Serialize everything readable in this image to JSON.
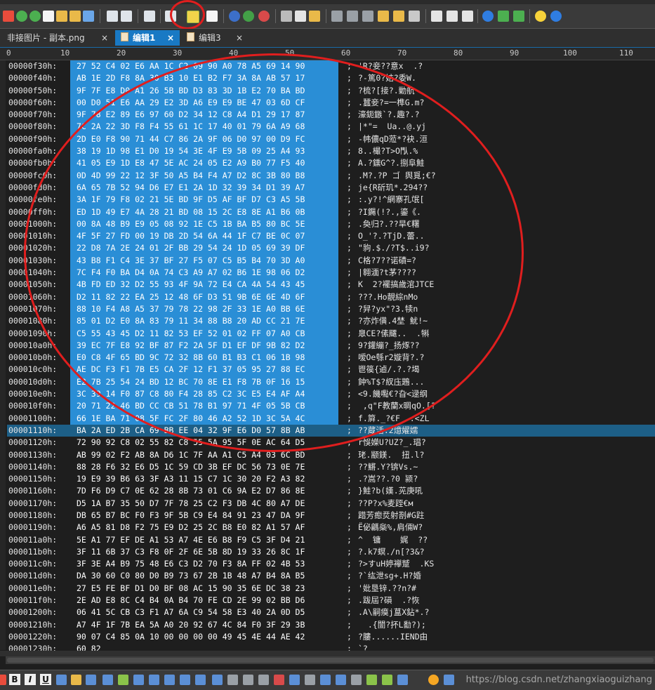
{
  "tabs": [
    {
      "label": "非接图片 - 副本.png",
      "close": "×"
    },
    {
      "label": "编辑1",
      "close": "×"
    },
    {
      "label": "编辑3",
      "close": "×"
    }
  ],
  "ruler": [
    "0",
    "10",
    "20",
    "30",
    "40",
    "50",
    "60",
    "70",
    "80",
    "90",
    "100",
    "110"
  ],
  "separator": ";",
  "rows": [
    {
      "addr": "00000f30h:",
      "hex": "27 52 C4 02 E6 AA 1C C2 09 90 A0 78 A5 69 14 90",
      "ascii": "'R?妾??意x  .?",
      "sel": true
    },
    {
      "addr": "00000f40h:",
      "hex": "AB 1E 2D F8 8A 30 B3 10 E1 B2 F7 3A 8A AB 57 17",
      "ascii": "?-篤0?姞?委W.",
      "sel": true
    },
    {
      "addr": "00000f50h:",
      "hex": "9F 7F E8 D0 A1 26 5B BD D3 83 3D 1B E2 70 BA BD",
      "ascii": "?梳?[接?.勦航",
      "sel": true
    },
    {
      "addr": "00000f60h:",
      "hex": "00 D0 51 E6 AA 29 E2 3D A6 E9 E9 BE 47 03 6D CF",
      "ascii": ".蠶妾?=一榫G.m?",
      "sel": true
    },
    {
      "addr": "00000f70h:",
      "hex": "9F 78 E2 89 E6 97 60 D2 34 12 C8 A4 D1 29 17 87",
      "ascii": "濠鈪鏃`?.趣?.?",
      "sel": true
    },
    {
      "addr": "00000f80h:",
      "hex": "7C 2A 22 3D F8 F4 55 61 1C 17 40 01 79 6A A9 68",
      "ascii": "|*\"=  Ua..@.yj",
      "sel": true
    },
    {
      "addr": "00000f90h:",
      "hex": "2D E0 F8 90 71 44 C7 86 2A 9F 06 D0 97 00 D9 FC",
      "ascii": "-帏儂qD蒞*?袂.洹",
      "sel": true
    },
    {
      "addr": "00000fa0h:",
      "hex": "38 19 1D 98 E1 D0 19 54 3E 4F E9 5B 09 25 A4 93",
      "ascii": "8..樶?T>O閄.%",
      "sel": true
    },
    {
      "addr": "00000fb0h:",
      "hex": "41 05 E9 1D E8 47 5E AC 24 05 E2 A9 B0 77 F5 40",
      "ascii": "A.?鑂G^?.捌阜鮭",
      "sel": true
    },
    {
      "addr": "00000fc0h:",
      "hex": "0D 4D 99 22 12 3F 50 A5 B4 F4 A7 D2 8C 3B 80 B8",
      "ascii": ".M?.?P ゴ 舆覓;€?",
      "sel": true
    },
    {
      "addr": "00000fd0h:",
      "hex": "6A 65 7B 52 94 D6 E7 E1 2A 1D 32 39 34 D1 39 A7",
      "ascii": "je{R斫玑*.294??",
      "sel": true
    },
    {
      "addr": "00000fe0h:",
      "hex": "3A 1F 79 F8 02 21 5E BD 9F D5 AF BF D7 C3 A5 5B",
      "ascii": ":.y?!^網寨孔氓[",
      "sel": true
    },
    {
      "addr": "00000ff0h:",
      "hex": "ED 1D 49 E7 4A 28 21 BD 08 15 2C E8 8E A1 B6 0B",
      "ascii": "?I鐊(!?.,鎏《.",
      "sel": true
    },
    {
      "addr": "00001000h:",
      "hex": "00 8A 48 B9 E9 05 08 92 1E C5 1B BA B5 80 BC 5E",
      "ascii": ".奐归?.??旱€糬",
      "sel": true
    },
    {
      "addr": "00001010h:",
      "hex": "4F 5F 27 FD 00 19 DB 2D 54 6A 44 1F C7 BE 0C 07",
      "ascii": "O_'?.?TjD.蕾..",
      "sel": true
    },
    {
      "addr": "00001020h:",
      "hex": "22 D8 7A 2E 24 01 2F BB 29 54 24 1D 05 69 39 DF",
      "ascii": "\"豿.$./?T$..i9?",
      "sel": true
    },
    {
      "addr": "00001030h:",
      "hex": "43 B8 F1 C4 3E 37 BF 27 F5 07 C5 B5 B4 70 3D A0",
      "ascii": "C格?7??诺磧=?",
      "sel": true
    },
    {
      "addr": "00001040h:",
      "hex": "7C F4 F0 BA D4 0A 74 C3 A9 A7 02 B6 1E 98 06 D2",
      "ascii": "|翱湎?t茅????",
      "sel": true
    },
    {
      "addr": "00001050h:",
      "hex": "4B FD ED 32 D2 55 93 4F 9A 72 E4 CA 4A 54 43 45",
      "ascii": "K  2?襬搞歲涫JTCE",
      "sel": true
    },
    {
      "addr": "00001060h:",
      "hex": "D2 11 82 22 EA 25 12 48 6F D3 51 9B 6E 6E 4D 6F",
      "ascii": "???.Ho靚綜nMo",
      "sel": true
    },
    {
      "addr": "00001070h:",
      "hex": "88 10 F4 A8 A5 37 79 78 22 98 2F 33 1E A0 BB 6E",
      "ascii": "?舁?yx\"?3.犊n",
      "sel": true
    },
    {
      "addr": "00001080h:",
      "hex": "85 01 D2 E0 8A 83 79 11 34 88 B8 20 AD CC 21 7E",
      "ascii": "?亦炸僙.4埜 魷!~",
      "sel": true
    },
    {
      "addr": "00001090h:",
      "hex": "C5 55 43 45 D2 11 82 53 EF 52 01 02 FF 07 A0 CB",
      "ascii": "臮CE?傃飅..  .犐",
      "sel": true
    },
    {
      "addr": "000010a0h:",
      "hex": "39 EC 7F E8 92 BF 87 F2 2A 5F D1 EF DF 9B 82 D2",
      "ascii": "9?鑵繃?_扬烼??",
      "sel": true
    },
    {
      "addr": "000010b0h:",
      "hex": "E0 C8 4F 65 BD 9C 72 32 8B 60 B1 B3 C1 06 1B 98",
      "ascii": "嗳Oe綔r2嫙背?.?",
      "sel": true
    },
    {
      "addr": "000010c0h:",
      "hex": "AE DC F3 F1 7B E5 CA 2F 12 F1 37 05 95 27 88 EC",
      "ascii": "鬯篌{逌/.?.?堨",
      "sel": true
    },
    {
      "addr": "000010d0h:",
      "hex": "E2 7B 25 54 24 BD 12 BC 70 8E E1 F8 7B 0F 16 15",
      "ascii": "鈡%T$?紁庒鶗...",
      "sel": true
    },
    {
      "addr": "000010e0h:",
      "hex": "3C 39 14 F0 87 C8 80 F4 28 85 C2 3C E5 E4 AF A4",
      "ascii": "<9.饑嚸€?旮<逯纲",
      "sel": true
    },
    {
      "addr": "000010f0h:",
      "hex": "20 71 22 46 BD CC CB 51 78 B1 97 71 4F 05 5B CB",
      "ascii": " ,q\"F教蘭x晭qO.[?",
      "sel": true
    },
    {
      "addr": "00001100h:",
      "hex": "66 1E BA 71 08 5F FC 2F 80 46 A2 52 1D 3C 5A 4C",
      "ascii": "f.簈._?€F  .<ZL",
      "sel": true
    },
    {
      "addr": "00001110h:",
      "hex": "BA 2A ED 2B CA 69 BB EE 04 32 9F E6 D0 57 8B AB",
      "ascii": "??蔵活.2燱嬥嬬",
      "sel": true,
      "cur": true
    },
    {
      "addr": "00001120h:",
      "hex": "72 90 92 C8 02 55 82 C8 55 5A 95 5F 0E AC 64 D5",
      "ascii": "r悞嬫U?UZ?_.琩?",
      "sel": false
    },
    {
      "addr": "00001130h:",
      "hex": "AB 99 02 F2 AB 8A D6 1C 7F AA A1 C5 A4 03 6C BD",
      "ascii": "珯.颛鎂.  扭.l?",
      "sel": false
    },
    {
      "addr": "00001140h:",
      "hex": "88 28 F6 32 E6 D5 1C 59 CD 3B EF DC 56 73 0E 7E",
      "ascii": "??鱂.Y?锛Vs.~",
      "sel": false
    },
    {
      "addr": "00001150h:",
      "hex": "19 E9 39 B6 63 3F A3 11 15 C7 1C 30 20 F2 A3 82",
      "ascii": ".?嵩??.?0 颍?",
      "sel": false
    },
    {
      "addr": "00001160h:",
      "hex": "7D F6 D9 C7 0E 62 28 8B 73 01 C6 9A E2 D7 86 8E",
      "ascii": "}鮭?b(嫨.茪庚吼",
      "sel": false
    },
    {
      "addr": "00001170h:",
      "hex": "D5 1A B7 35 50 D7 7F 78 25 C2 F3 DB 4C 80 A7 DE",
      "ascii": "??P?x%麦跮€м",
      "sel": false
    },
    {
      "addr": "00001180h:",
      "hex": "DB 65 B7 BC F0 F3 9F 5B C9 E4 84 91 23 47 DA 9F",
      "ascii": "踖芳瘛烎射剳#G跓",
      "sel": false
    },
    {
      "addr": "00001190h:",
      "hex": "A6 A5 81 D8 F2 75 E9 D2 25 2C B8 E0 82 A1 57 AF",
      "ascii": "Ё佖騗橤%,肩倆W?",
      "sel": false
    },
    {
      "addr": "000011a0h:",
      "hex": "5E A1 77 EF DE A1 53 A7 4E E6 B8 F9 C5 3F D4 21",
      "ascii": "^  镛    娓  ??",
      "sel": false
    },
    {
      "addr": "000011b0h:",
      "hex": "3F 11 6B 37 C3 F8 0F 2F 6E 5B 8D 19 33 26 8C 1F",
      "ascii": "?.k7螟./n[?3&?",
      "sel": false
    },
    {
      "addr": "000011c0h:",
      "hex": "3F 3E A4 B9 75 48 E6 C3 D2 70 F3 8A FF 02 4B 53",
      "ascii": "?>すuH婷襷蹵  .KS",
      "sel": false
    },
    {
      "addr": "000011d0h:",
      "hex": "DA 30 60 C0 80 D0 B9 73 67 2B 1B 48 A7 B4 8A B5",
      "ascii": "?`纮泄sg+.H?婚",
      "sel": false
    },
    {
      "addr": "000011e0h:",
      "hex": "27 E5 FE BF D1 D0 BF 08 AC 15 90 35 6E DC 38 23",
      "ascii": "'妣垦锌.??n?#",
      "sel": false
    },
    {
      "addr": "000011f0h:",
      "hex": "2E AD E8 8C C4 B4 0A B4 70 FE CD 2E 99 02 BB D6",
      "ascii": ".跋屆?磒  .?恢",
      "sel": false
    },
    {
      "addr": "00001200h:",
      "hex": "06 41 5C CB C3 F1 A7 6A C9 54 58 E3 40 2A 0D D5",
      "ascii": ".A\\嗣瘼j蒀X鉆*.?",
      "sel": false
    },
    {
      "addr": "00001210h:",
      "hex": "A7 4F 1F 7B EA 5A A0 20 92 67 4C 84 F0 3F 29 3B",
      "ascii": "  .{闓?抔L勫?);",
      "sel": false
    },
    {
      "addr": "00001220h:",
      "hex": "90 07 C4 85 0A 10 00 00 00 00 49 45 4E 44 AE 42",
      "ascii": "?膢......IEND甶",
      "sel": false
    },
    {
      "addr": "00001230h:",
      "hex": "60 82",
      "ascii": "`?",
      "sel": false
    }
  ],
  "watermark": "https://blog.csdn.net/zhangxiaoguizhang"
}
